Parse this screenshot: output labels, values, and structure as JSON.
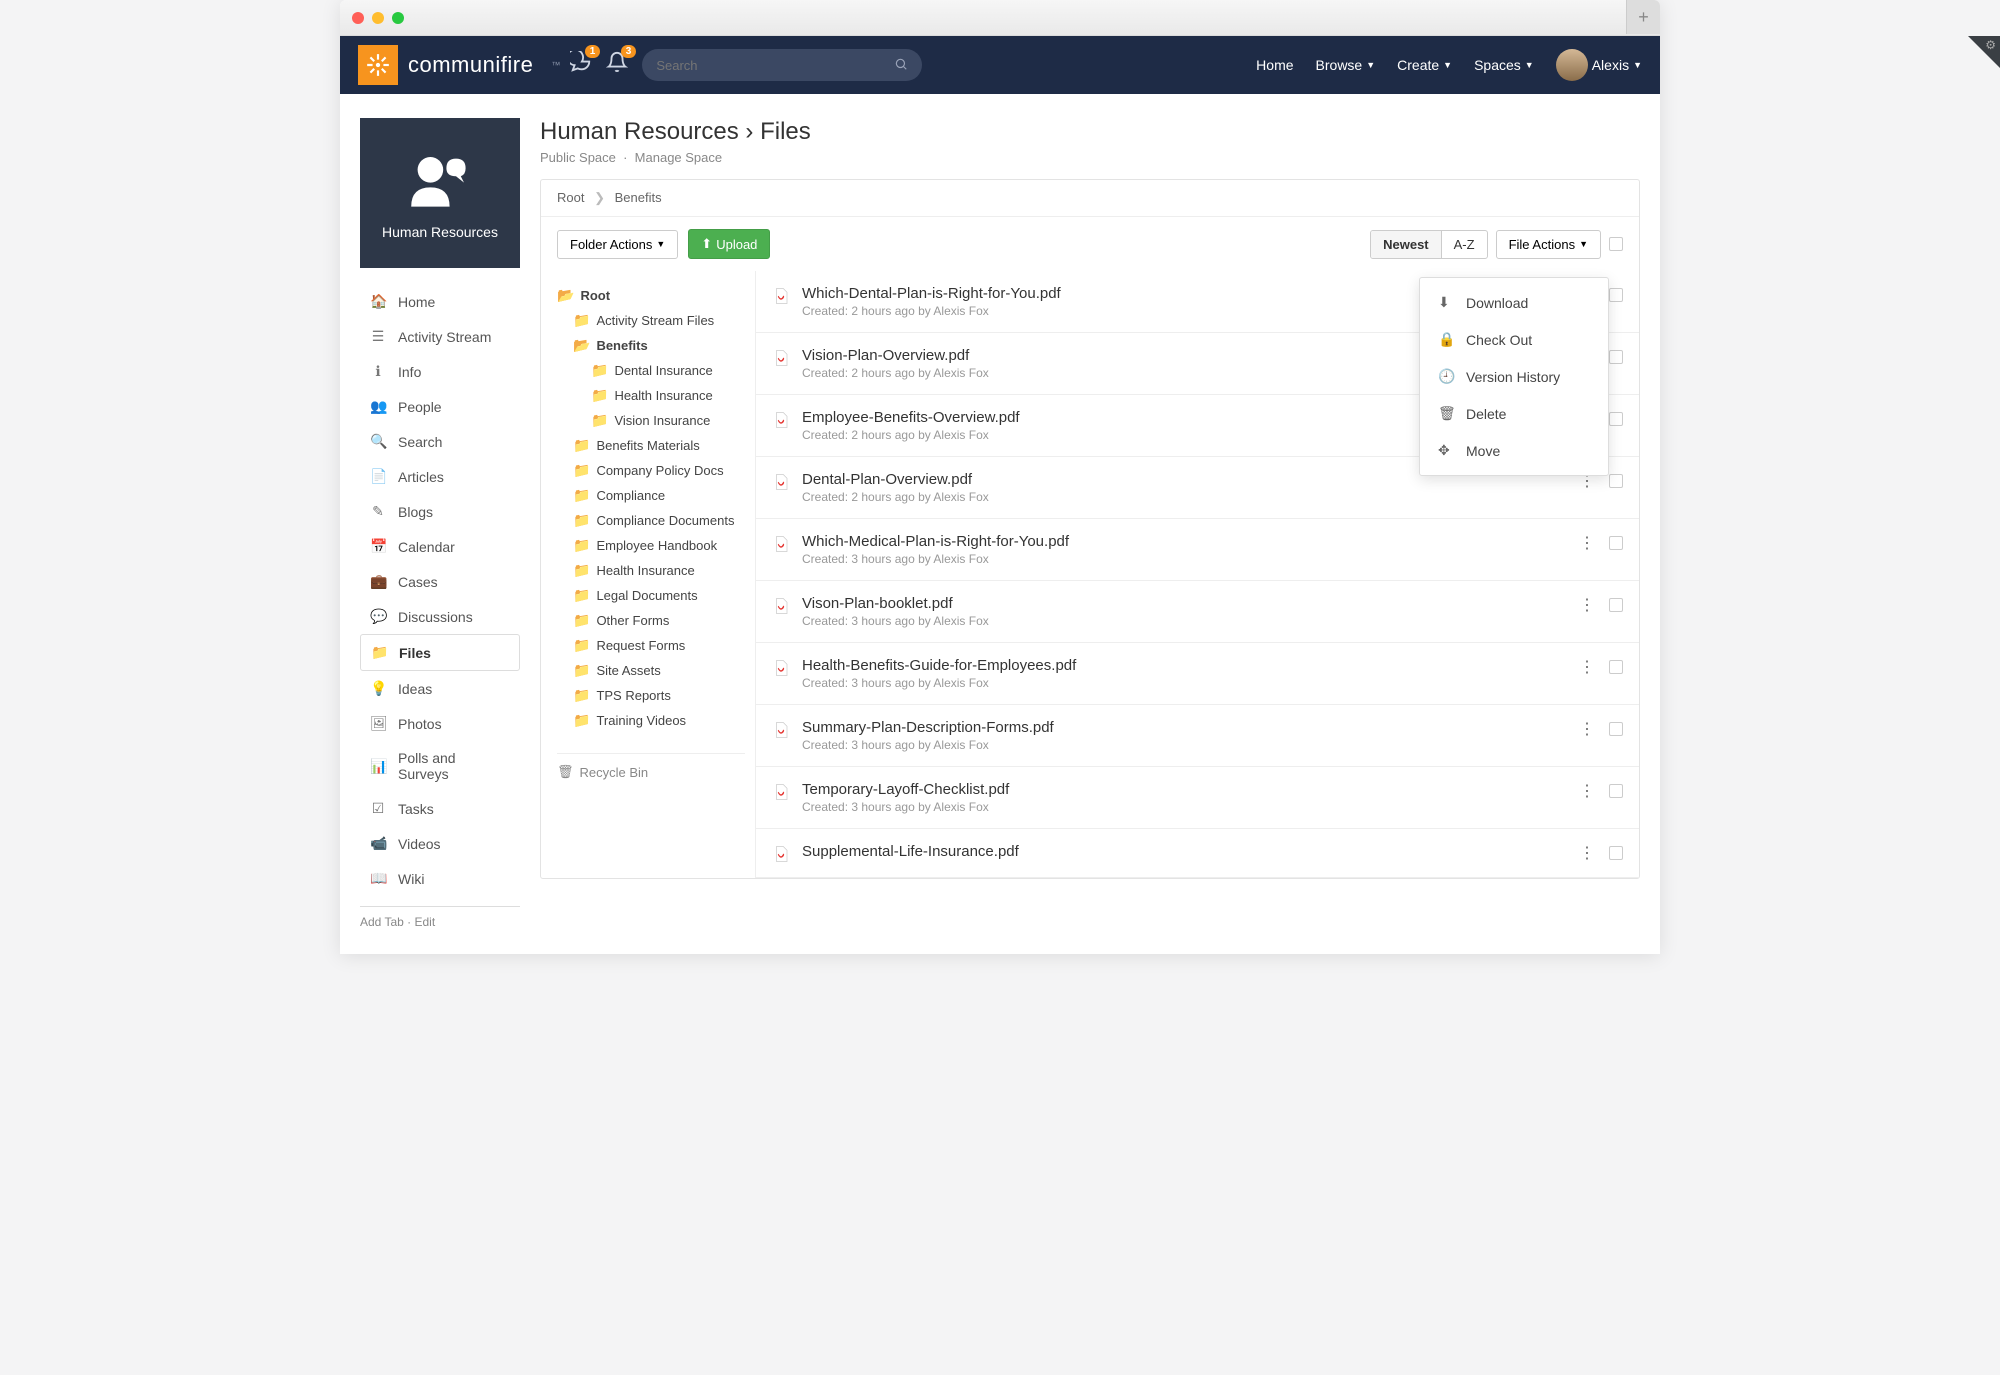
{
  "brand": "communifire",
  "notifications": {
    "messages": "1",
    "alerts": "3"
  },
  "search": {
    "placeholder": "Search"
  },
  "topnav": {
    "home": "Home",
    "browse": "Browse",
    "create": "Create",
    "spaces": "Spaces",
    "user": "Alexis"
  },
  "space": {
    "name": "Human Resources",
    "title_part1": "Human Resources",
    "title_sep": "›",
    "title_part2": "Files",
    "visibility": "Public Space",
    "manage": "Manage Space"
  },
  "sidenav": [
    {
      "icon": "home",
      "label": "Home"
    },
    {
      "icon": "stream",
      "label": "Activity Stream"
    },
    {
      "icon": "info",
      "label": "Info"
    },
    {
      "icon": "people",
      "label": "People"
    },
    {
      "icon": "search",
      "label": "Search"
    },
    {
      "icon": "article",
      "label": "Articles"
    },
    {
      "icon": "blog",
      "label": "Blogs"
    },
    {
      "icon": "calendar",
      "label": "Calendar"
    },
    {
      "icon": "case",
      "label": "Cases"
    },
    {
      "icon": "discuss",
      "label": "Discussions"
    },
    {
      "icon": "files",
      "label": "Files",
      "active": true
    },
    {
      "icon": "idea",
      "label": "Ideas"
    },
    {
      "icon": "photo",
      "label": "Photos"
    },
    {
      "icon": "poll",
      "label": "Polls and Surveys"
    },
    {
      "icon": "task",
      "label": "Tasks"
    },
    {
      "icon": "video",
      "label": "Videos"
    },
    {
      "icon": "wiki",
      "label": "Wiki"
    }
  ],
  "sidefooter": {
    "add": "Add Tab",
    "edit": "Edit"
  },
  "breadcrumb": {
    "root": "Root",
    "current": "Benefits"
  },
  "buttons": {
    "folder_actions": "Folder Actions",
    "upload": "Upload",
    "newest": "Newest",
    "az": "A-Z",
    "file_actions": "File Actions"
  },
  "tree": {
    "root": "Root",
    "items": [
      {
        "label": "Activity Stream Files",
        "indent": 1
      },
      {
        "label": "Benefits",
        "indent": 1,
        "bold": true,
        "open": true
      },
      {
        "label": "Dental Insurance",
        "indent": 2
      },
      {
        "label": "Health Insurance",
        "indent": 2
      },
      {
        "label": "Vision Insurance",
        "indent": 2
      },
      {
        "label": "Benefits Materials",
        "indent": 1
      },
      {
        "label": "Company Policy Docs",
        "indent": 1
      },
      {
        "label": "Compliance",
        "indent": 1
      },
      {
        "label": "Compliance Documents",
        "indent": 1
      },
      {
        "label": "Employee Handbook",
        "indent": 1
      },
      {
        "label": "Health Insurance",
        "indent": 1
      },
      {
        "label": "Legal Documents",
        "indent": 1
      },
      {
        "label": "Other Forms",
        "indent": 1
      },
      {
        "label": "Request Forms",
        "indent": 1
      },
      {
        "label": "Site Assets",
        "indent": 1
      },
      {
        "label": "TPS Reports",
        "indent": 1
      },
      {
        "label": "Training Videos",
        "indent": 1
      }
    ],
    "recycle": "Recycle Bin"
  },
  "files": [
    {
      "name": "Which-Dental-Plan-is-Right-for-You.pdf",
      "meta": "Created: 2 hours ago by Alexis Fox",
      "menu": true
    },
    {
      "name": "Vision-Plan-Overview.pdf",
      "meta": "Created: 2 hours ago by Alexis Fox"
    },
    {
      "name": "Employee-Benefits-Overview.pdf",
      "meta": "Created: 2 hours ago by Alexis Fox"
    },
    {
      "name": "Dental-Plan-Overview.pdf",
      "meta": "Created: 2 hours ago by Alexis Fox"
    },
    {
      "name": "Which-Medical-Plan-is-Right-for-You.pdf",
      "meta": "Created: 3 hours ago by Alexis Fox"
    },
    {
      "name": "Vison-Plan-booklet.pdf",
      "meta": "Created: 3 hours ago by Alexis Fox"
    },
    {
      "name": "Health-Benefits-Guide-for-Employees.pdf",
      "meta": "Created: 3 hours ago by Alexis Fox"
    },
    {
      "name": "Summary-Plan-Description-Forms.pdf",
      "meta": "Created: 3 hours ago by Alexis Fox"
    },
    {
      "name": "Temporary-Layoff-Checklist.pdf",
      "meta": "Created: 3 hours ago by Alexis Fox"
    },
    {
      "name": "Supplemental-Life-Insurance.pdf",
      "meta": ""
    }
  ],
  "context_menu": [
    {
      "icon": "download",
      "label": "Download"
    },
    {
      "icon": "lock",
      "label": "Check Out"
    },
    {
      "icon": "clock",
      "label": "Version History"
    },
    {
      "icon": "trash",
      "label": "Delete"
    },
    {
      "icon": "move",
      "label": "Move"
    }
  ]
}
